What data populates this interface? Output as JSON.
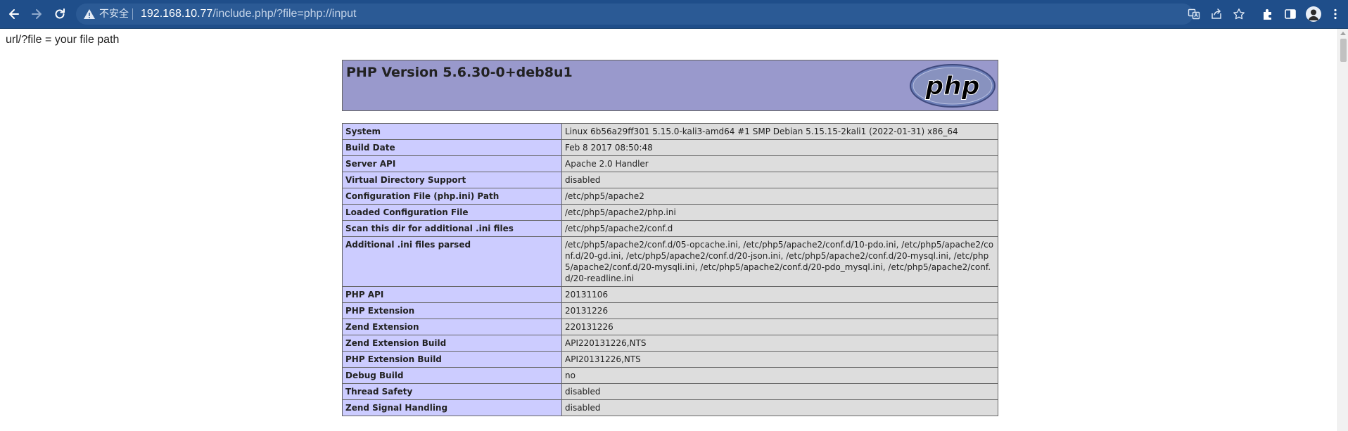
{
  "browser": {
    "insecure_label": "不安全",
    "url_host": "192.168.10.77",
    "url_path": "/include.php/?file=php://input"
  },
  "page": {
    "intro_text": "url/?file = your file path",
    "php_version_title": "PHP Version 5.6.30-0+deb8u1",
    "logo_text": "php"
  },
  "info_rows": [
    {
      "key": "System",
      "value": "Linux 6b56a29ff301 5.15.0-kali3-amd64 #1 SMP Debian 5.15.15-2kali1 (2022-01-31) x86_64"
    },
    {
      "key": "Build Date",
      "value": "Feb 8 2017 08:50:48"
    },
    {
      "key": "Server API",
      "value": "Apache 2.0 Handler"
    },
    {
      "key": "Virtual Directory Support",
      "value": "disabled"
    },
    {
      "key": "Configuration File (php.ini) Path",
      "value": "/etc/php5/apache2"
    },
    {
      "key": "Loaded Configuration File",
      "value": "/etc/php5/apache2/php.ini"
    },
    {
      "key": "Scan this dir for additional .ini files",
      "value": "/etc/php5/apache2/conf.d"
    },
    {
      "key": "Additional .ini files parsed",
      "value": "/etc/php5/apache2/conf.d/05-opcache.ini, /etc/php5/apache2/conf.d/10-pdo.ini, /etc/php5/apache2/conf.d/20-gd.ini, /etc/php5/apache2/conf.d/20-json.ini, /etc/php5/apache2/conf.d/20-mysql.ini, /etc/php5/apache2/conf.d/20-mysqli.ini, /etc/php5/apache2/conf.d/20-pdo_mysql.ini, /etc/php5/apache2/conf.d/20-readline.ini"
    },
    {
      "key": "PHP API",
      "value": "20131106"
    },
    {
      "key": "PHP Extension",
      "value": "20131226"
    },
    {
      "key": "Zend Extension",
      "value": "220131226"
    },
    {
      "key": "Zend Extension Build",
      "value": "API220131226,NTS"
    },
    {
      "key": "PHP Extension Build",
      "value": "API20131226,NTS"
    },
    {
      "key": "Debug Build",
      "value": "no"
    },
    {
      "key": "Thread Safety",
      "value": "disabled"
    },
    {
      "key": "Zend Signal Handling",
      "value": "disabled"
    }
  ],
  "colors": {
    "toolbar": "#1f4e8a",
    "php_header": "#9999cc",
    "key_cell": "#ccccff",
    "value_cell": "#dddddd"
  }
}
